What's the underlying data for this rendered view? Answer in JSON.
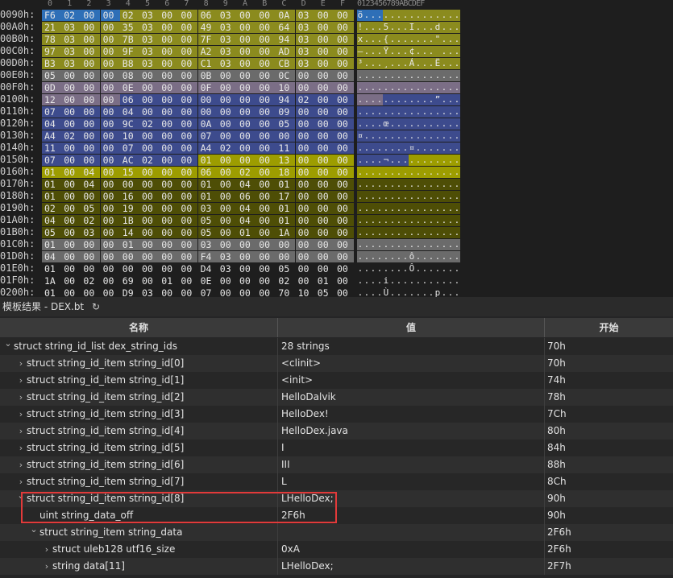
{
  "hex": {
    "column_headers": [
      "0",
      "1",
      "2",
      "3",
      "4",
      "5",
      "6",
      "7",
      "8",
      "9",
      "A",
      "B",
      "C",
      "D",
      "E",
      "F"
    ],
    "ascii_header": "0123456789ABCDEF",
    "colors": {
      "olive": "#8b8b1e",
      "gray": "#6b6b6b",
      "mauve": "#7b6e86",
      "blue": "#3d4b8d",
      "yellow": "#9d9d00",
      "dark_olive": "#4e4e06",
      "selection": "#2e6fb7"
    },
    "rows": [
      {
        "addr": "0090h:",
        "bytes": [
          "F6",
          "02",
          "00",
          "00",
          "02",
          "03",
          "00",
          "00",
          "06",
          "03",
          "00",
          "00",
          "0A",
          "03",
          "00",
          "00"
        ],
        "ascii": "ö...............",
        "colors": [
          "sel",
          "sel",
          "sel",
          "sel",
          "olive",
          "olive",
          "olive",
          "olive",
          "olive",
          "olive",
          "olive",
          "olive",
          "olive",
          "olive",
          "olive",
          "olive"
        ]
      },
      {
        "addr": "00A0h:",
        "bytes": [
          "21",
          "03",
          "00",
          "00",
          "35",
          "03",
          "00",
          "00",
          "49",
          "03",
          "00",
          "00",
          "64",
          "03",
          "00",
          "00"
        ],
        "ascii": "!...5...I...d...",
        "colors": [
          "olive",
          "olive",
          "olive",
          "olive",
          "olive",
          "olive",
          "olive",
          "olive",
          "olive",
          "olive",
          "olive",
          "olive",
          "olive",
          "olive",
          "olive",
          "olive"
        ]
      },
      {
        "addr": "00B0h:",
        "bytes": [
          "78",
          "03",
          "00",
          "00",
          "7B",
          "03",
          "00",
          "00",
          "7F",
          "03",
          "00",
          "00",
          "94",
          "03",
          "00",
          "00"
        ],
        "ascii": "x...{.......\"...",
        "colors": [
          "olive",
          "olive",
          "olive",
          "olive",
          "olive",
          "olive",
          "olive",
          "olive",
          "olive",
          "olive",
          "olive",
          "olive",
          "olive",
          "olive",
          "olive",
          "olive"
        ]
      },
      {
        "addr": "00C0h:",
        "bytes": [
          "97",
          "03",
          "00",
          "00",
          "9F",
          "03",
          "00",
          "00",
          "A2",
          "03",
          "00",
          "00",
          "AD",
          "03",
          "00",
          "00"
        ],
        "ascii": "—...Ÿ...¢...­...",
        "colors": [
          "olive",
          "olive",
          "olive",
          "olive",
          "olive",
          "olive",
          "olive",
          "olive",
          "olive",
          "olive",
          "olive",
          "olive",
          "olive",
          "olive",
          "olive",
          "olive"
        ]
      },
      {
        "addr": "00D0h:",
        "bytes": [
          "B3",
          "03",
          "00",
          "00",
          "B8",
          "03",
          "00",
          "00",
          "C1",
          "03",
          "00",
          "00",
          "CB",
          "03",
          "00",
          "00"
        ],
        "ascii": "³...¸...Á...Ë...",
        "colors": [
          "olive",
          "olive",
          "olive",
          "olive",
          "olive",
          "olive",
          "olive",
          "olive",
          "olive",
          "olive",
          "olive",
          "olive",
          "olive",
          "olive",
          "olive",
          "olive"
        ]
      },
      {
        "addr": "00E0h:",
        "bytes": [
          "05",
          "00",
          "00",
          "00",
          "08",
          "00",
          "00",
          "00",
          "0B",
          "00",
          "00",
          "00",
          "0C",
          "00",
          "00",
          "00"
        ],
        "ascii": "................",
        "colors": [
          "gray",
          "gray",
          "gray",
          "gray",
          "gray",
          "gray",
          "gray",
          "gray",
          "gray",
          "gray",
          "gray",
          "gray",
          "gray",
          "gray",
          "gray",
          "gray"
        ]
      },
      {
        "addr": "00F0h:",
        "bytes": [
          "0D",
          "00",
          "00",
          "00",
          "0E",
          "00",
          "00",
          "00",
          "0F",
          "00",
          "00",
          "00",
          "10",
          "00",
          "00",
          "00"
        ],
        "ascii": "................",
        "colors": [
          "mauve",
          "mauve",
          "mauve",
          "mauve",
          "mauve",
          "mauve",
          "mauve",
          "mauve",
          "mauve",
          "mauve",
          "mauve",
          "mauve",
          "mauve",
          "mauve",
          "mauve",
          "mauve"
        ]
      },
      {
        "addr": "0100h:",
        "bytes": [
          "12",
          "00",
          "00",
          "00",
          "06",
          "00",
          "00",
          "00",
          "00",
          "00",
          "00",
          "00",
          "94",
          "02",
          "00",
          "00"
        ],
        "ascii": "............”...",
        "colors": [
          "mauve",
          "mauve",
          "mauve",
          "mauve",
          "blue",
          "blue",
          "blue",
          "blue",
          "blue",
          "blue",
          "blue",
          "blue",
          "blue",
          "blue",
          "blue",
          "blue"
        ]
      },
      {
        "addr": "0110h:",
        "bytes": [
          "07",
          "00",
          "00",
          "00",
          "04",
          "00",
          "00",
          "00",
          "00",
          "00",
          "00",
          "00",
          "09",
          "00",
          "00",
          "00"
        ],
        "ascii": "................",
        "colors": [
          "blue",
          "blue",
          "blue",
          "blue",
          "blue",
          "blue",
          "blue",
          "blue",
          "blue",
          "blue",
          "blue",
          "blue",
          "blue",
          "blue",
          "blue",
          "blue"
        ]
      },
      {
        "addr": "0120h:",
        "bytes": [
          "04",
          "00",
          "00",
          "00",
          "9C",
          "02",
          "00",
          "00",
          "0A",
          "00",
          "00",
          "00",
          "05",
          "00",
          "00",
          "00"
        ],
        "ascii": "....œ...........",
        "colors": [
          "blue",
          "blue",
          "blue",
          "blue",
          "blue",
          "blue",
          "blue",
          "blue",
          "blue",
          "blue",
          "blue",
          "blue",
          "blue",
          "blue",
          "blue",
          "blue"
        ]
      },
      {
        "addr": "0130h:",
        "bytes": [
          "A4",
          "02",
          "00",
          "00",
          "10",
          "00",
          "00",
          "00",
          "07",
          "00",
          "00",
          "00",
          "00",
          "00",
          "00",
          "00"
        ],
        "ascii": "¤...............",
        "colors": [
          "blue",
          "blue",
          "blue",
          "blue",
          "blue",
          "blue",
          "blue",
          "blue",
          "blue",
          "blue",
          "blue",
          "blue",
          "blue",
          "blue",
          "blue",
          "blue"
        ]
      },
      {
        "addr": "0140h:",
        "bytes": [
          "11",
          "00",
          "00",
          "00",
          "07",
          "00",
          "00",
          "00",
          "A4",
          "02",
          "00",
          "00",
          "11",
          "00",
          "00",
          "00"
        ],
        "ascii": "........¤.......",
        "colors": [
          "blue",
          "blue",
          "blue",
          "blue",
          "blue",
          "blue",
          "blue",
          "blue",
          "blue",
          "blue",
          "blue",
          "blue",
          "blue",
          "blue",
          "blue",
          "blue"
        ]
      },
      {
        "addr": "0150h:",
        "bytes": [
          "07",
          "00",
          "00",
          "00",
          "AC",
          "02",
          "00",
          "00",
          "01",
          "00",
          "00",
          "00",
          "13",
          "00",
          "00",
          "00"
        ],
        "ascii": "....¬...........",
        "colors": [
          "blue",
          "blue",
          "blue",
          "blue",
          "blue",
          "blue",
          "blue",
          "blue",
          "yellow",
          "yellow",
          "yellow",
          "yellow",
          "yellow",
          "yellow",
          "yellow",
          "yellow"
        ]
      },
      {
        "addr": "0160h:",
        "bytes": [
          "01",
          "00",
          "04",
          "00",
          "15",
          "00",
          "00",
          "00",
          "06",
          "00",
          "02",
          "00",
          "18",
          "00",
          "00",
          "00"
        ],
        "ascii": "................",
        "colors": [
          "yellow",
          "yellow",
          "yellow",
          "yellow",
          "yellow",
          "yellow",
          "yellow",
          "yellow",
          "yellow",
          "yellow",
          "yellow",
          "yellow",
          "yellow",
          "yellow",
          "yellow",
          "yellow"
        ]
      },
      {
        "addr": "0170h:",
        "bytes": [
          "01",
          "00",
          "04",
          "00",
          "00",
          "00",
          "00",
          "00",
          "01",
          "00",
          "04",
          "00",
          "01",
          "00",
          "00",
          "00"
        ],
        "ascii": "................",
        "colors": [
          "dark_olive",
          "dark_olive",
          "dark_olive",
          "dark_olive",
          "dark_olive",
          "dark_olive",
          "dark_olive",
          "dark_olive",
          "dark_olive",
          "dark_olive",
          "dark_olive",
          "dark_olive",
          "dark_olive",
          "dark_olive",
          "dark_olive",
          "dark_olive"
        ]
      },
      {
        "addr": "0180h:",
        "bytes": [
          "01",
          "00",
          "00",
          "00",
          "16",
          "00",
          "00",
          "00",
          "01",
          "00",
          "06",
          "00",
          "17",
          "00",
          "00",
          "00"
        ],
        "ascii": "................",
        "colors": [
          "dark_olive",
          "dark_olive",
          "dark_olive",
          "dark_olive",
          "dark_olive",
          "dark_olive",
          "dark_olive",
          "dark_olive",
          "dark_olive",
          "dark_olive",
          "dark_olive",
          "dark_olive",
          "dark_olive",
          "dark_olive",
          "dark_olive",
          "dark_olive"
        ]
      },
      {
        "addr": "0190h:",
        "bytes": [
          "02",
          "00",
          "05",
          "00",
          "19",
          "00",
          "00",
          "00",
          "03",
          "00",
          "04",
          "00",
          "01",
          "00",
          "00",
          "00"
        ],
        "ascii": "................",
        "colors": [
          "dark_olive",
          "dark_olive",
          "dark_olive",
          "dark_olive",
          "dark_olive",
          "dark_olive",
          "dark_olive",
          "dark_olive",
          "dark_olive",
          "dark_olive",
          "dark_olive",
          "dark_olive",
          "dark_olive",
          "dark_olive",
          "dark_olive",
          "dark_olive"
        ]
      },
      {
        "addr": "01A0h:",
        "bytes": [
          "04",
          "00",
          "02",
          "00",
          "1B",
          "00",
          "00",
          "00",
          "05",
          "00",
          "04",
          "00",
          "01",
          "00",
          "00",
          "00"
        ],
        "ascii": "................",
        "colors": [
          "dark_olive",
          "dark_olive",
          "dark_olive",
          "dark_olive",
          "dark_olive",
          "dark_olive",
          "dark_olive",
          "dark_olive",
          "dark_olive",
          "dark_olive",
          "dark_olive",
          "dark_olive",
          "dark_olive",
          "dark_olive",
          "dark_olive",
          "dark_olive"
        ]
      },
      {
        "addr": "01B0h:",
        "bytes": [
          "05",
          "00",
          "03",
          "00",
          "14",
          "00",
          "00",
          "00",
          "05",
          "00",
          "01",
          "00",
          "1A",
          "00",
          "00",
          "00"
        ],
        "ascii": "................",
        "colors": [
          "dark_olive",
          "dark_olive",
          "dark_olive",
          "dark_olive",
          "dark_olive",
          "dark_olive",
          "dark_olive",
          "dark_olive",
          "dark_olive",
          "dark_olive",
          "dark_olive",
          "dark_olive",
          "dark_olive",
          "dark_olive",
          "dark_olive",
          "dark_olive"
        ]
      },
      {
        "addr": "01C0h:",
        "bytes": [
          "01",
          "00",
          "00",
          "00",
          "01",
          "00",
          "00",
          "00",
          "03",
          "00",
          "00",
          "00",
          "00",
          "00",
          "00",
          "00"
        ],
        "ascii": "................",
        "colors": [
          "gray",
          "gray",
          "gray",
          "gray",
          "gray",
          "gray",
          "gray",
          "gray",
          "gray",
          "gray",
          "gray",
          "gray",
          "gray",
          "gray",
          "gray",
          "gray"
        ]
      },
      {
        "addr": "01D0h:",
        "bytes": [
          "04",
          "00",
          "00",
          "00",
          "00",
          "00",
          "00",
          "00",
          "F4",
          "03",
          "00",
          "00",
          "00",
          "00",
          "00",
          "00"
        ],
        "ascii": "........ô.......",
        "colors": [
          "gray",
          "gray",
          "gray",
          "gray",
          "gray",
          "gray",
          "gray",
          "gray",
          "gray",
          "gray",
          "gray",
          "gray",
          "gray",
          "gray",
          "gray",
          "gray"
        ]
      },
      {
        "addr": "01E0h:",
        "bytes": [
          "01",
          "00",
          "00",
          "00",
          "00",
          "00",
          "00",
          "00",
          "D4",
          "03",
          "00",
          "00",
          "05",
          "00",
          "00",
          "00"
        ],
        "ascii": "........Ô.......",
        "colors": [
          "",
          "",
          "",
          "",
          "",
          "",
          "",
          "",
          "",
          "",
          "",
          "",
          "",
          "",
          "",
          ""
        ]
      },
      {
        "addr": "01F0h:",
        "bytes": [
          "1A",
          "00",
          "02",
          "00",
          "69",
          "00",
          "01",
          "00",
          "0E",
          "00",
          "00",
          "00",
          "02",
          "00",
          "01",
          "00"
        ],
        "ascii": "....i...........",
        "colors": [
          "",
          "",
          "",
          "",
          "",
          "",
          "",
          "",
          "",
          "",
          "",
          "",
          "",
          "",
          "",
          ""
        ]
      },
      {
        "addr": "0200h:",
        "bytes": [
          "01",
          "00",
          "00",
          "00",
          "D9",
          "03",
          "00",
          "00",
          "07",
          "00",
          "00",
          "00",
          "70",
          "10",
          "05",
          "00"
        ],
        "ascii": "....Ù.......p...",
        "colors": [
          "",
          "",
          "",
          "",
          "",
          "",
          "",
          "",
          "",
          "",
          "",
          "",
          "",
          "",
          "",
          ""
        ]
      }
    ]
  },
  "results_bar": {
    "title": "模板结果 - DEX.bt",
    "refresh_icon": "refresh-icon"
  },
  "template": {
    "headers": {
      "name": "名称",
      "value": "值",
      "start": "开始"
    },
    "rows": [
      {
        "indent": 0,
        "chev": "v",
        "name": "struct string_id_list dex_string_ids",
        "value": "28 strings",
        "start": "70h"
      },
      {
        "indent": 1,
        "chev": ">",
        "name": "struct string_id_item string_id[0]",
        "value": "<clinit>",
        "start": "70h"
      },
      {
        "indent": 1,
        "chev": ">",
        "name": "struct string_id_item string_id[1]",
        "value": "<init>",
        "start": "74h"
      },
      {
        "indent": 1,
        "chev": ">",
        "name": "struct string_id_item string_id[2]",
        "value": "HelloDalvik",
        "start": "78h"
      },
      {
        "indent": 1,
        "chev": ">",
        "name": "struct string_id_item string_id[3]",
        "value": "HelloDex!",
        "start": "7Ch"
      },
      {
        "indent": 1,
        "chev": ">",
        "name": "struct string_id_item string_id[4]",
        "value": "HelloDex.java",
        "start": "80h"
      },
      {
        "indent": 1,
        "chev": ">",
        "name": "struct string_id_item string_id[5]",
        "value": "I",
        "start": "84h"
      },
      {
        "indent": 1,
        "chev": ">",
        "name": "struct string_id_item string_id[6]",
        "value": "III",
        "start": "88h"
      },
      {
        "indent": 1,
        "chev": ">",
        "name": "struct string_id_item string_id[7]",
        "value": "L",
        "start": "8Ch"
      },
      {
        "indent": 1,
        "chev": "v",
        "name": "struct string_id_item string_id[8]",
        "value": "LHelloDex;",
        "start": "90h"
      },
      {
        "indent": 2,
        "chev": "",
        "name": "uint string_data_off",
        "value": "2F6h",
        "start": "90h"
      },
      {
        "indent": 2,
        "chev": "v",
        "name": "struct string_item string_data",
        "value": "",
        "start": "2F6h"
      },
      {
        "indent": 3,
        "chev": ">",
        "name": "struct uleb128 utf16_size",
        "value": "0xA",
        "start": "2F6h"
      },
      {
        "indent": 3,
        "chev": ">",
        "name": "string data[11]",
        "value": "LHelloDex;",
        "start": "2F7h"
      }
    ]
  }
}
